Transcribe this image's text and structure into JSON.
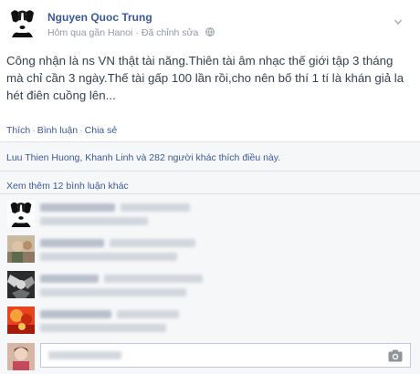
{
  "post": {
    "author": "Nguyen Quoc Trung",
    "location": "Hôm qua gần Hanoi",
    "separator": "·",
    "edited": "Đã chỉnh sửa",
    "text": "Công nhận là ns VN thật tài năng.Thiên tài âm nhạc thế giới tập 3 tháng mà chỉ cần 3 ngày.Thế tài gấp 100 lần rồi,cho nên bố thí 1 tí là khán giả la hét điên cuồng lên..."
  },
  "actions": {
    "like": "Thích",
    "comment": "Bình luận",
    "share": "Chia sẻ",
    "dot": "·"
  },
  "likes": {
    "text": "Luu Thien Huong, Khanh Linh và 282 người khác thích điều này."
  },
  "comments": {
    "view_more": "Xem thêm 12 bình luận khác"
  },
  "icons": {
    "audience": "globe-icon",
    "menu": "chevron-down-icon",
    "composer": "camera-icon"
  },
  "colors": {
    "link": "#3b5998",
    "meta": "#9197a3",
    "feedback_bg": "#f6f7f8"
  }
}
